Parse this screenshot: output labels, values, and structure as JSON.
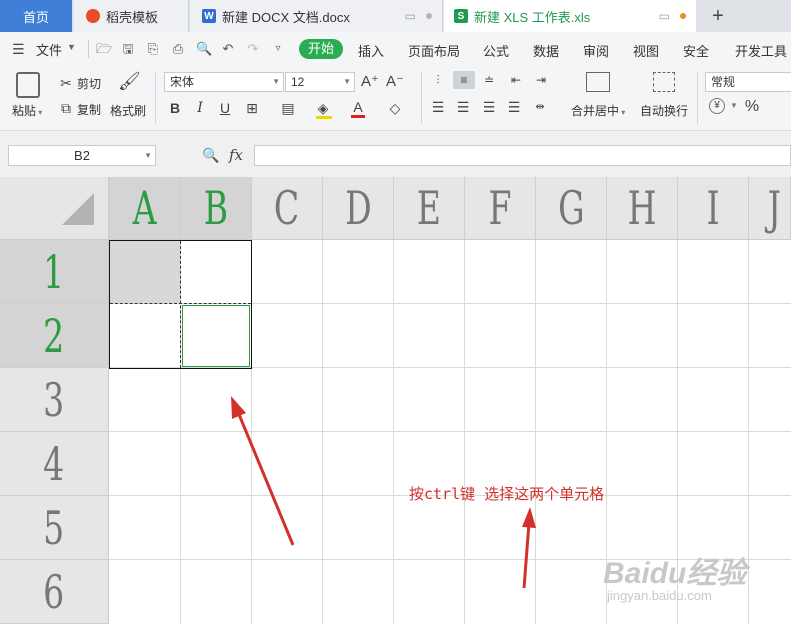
{
  "tabs": {
    "home": "首页",
    "daoke": "稻壳模板",
    "docx": "新建 DOCX 文档.docx",
    "xls": "新建 XLS 工作表.xls",
    "plus": "+"
  },
  "menu": {
    "file": "文件",
    "items": [
      "开始",
      "插入",
      "页面布局",
      "公式",
      "数据",
      "审阅",
      "视图",
      "安全",
      "开发工具"
    ]
  },
  "ribbon": {
    "paste": "粘贴",
    "cut": "剪切",
    "copy": "复制",
    "format_painter": "格式刷",
    "font_name": "宋体",
    "font_size": "12",
    "merge_center": "合并居中",
    "wrap_text": "自动换行",
    "number_format": "常规",
    "currency_symbol": "¥",
    "percent_symbol": "%"
  },
  "formula_bar": {
    "name_box": "B2",
    "fx": "fx",
    "value": ""
  },
  "grid": {
    "columns": [
      "A",
      "B",
      "C",
      "D",
      "E",
      "F",
      "G",
      "H",
      "I",
      "J"
    ],
    "rows": [
      "1",
      "2",
      "3",
      "4",
      "5",
      "6"
    ],
    "selected_cell": "B2"
  },
  "annotation": "按ctrl键 选择这两个单元格",
  "watermark": {
    "brand": "Baidu经验",
    "url": "jingyan.baidu.com"
  },
  "colors": {
    "accent_green": "#2bac52",
    "home_tab_blue": "#3f7fd8",
    "arrow_red": "#d2312b",
    "selection_green": "#2e9a44"
  }
}
